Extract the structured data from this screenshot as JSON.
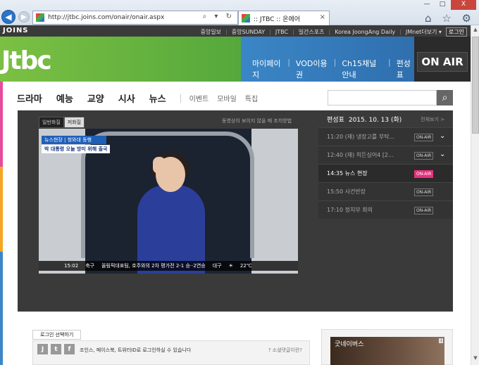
{
  "browser": {
    "url": "http://jtbc.joins.com/onair/onair.aspx",
    "tab_title": ":: JTBC :: 온에어",
    "window_buttons": [
      "—",
      "□",
      "X"
    ],
    "tool_icons": "⌂ ☆ ⚙",
    "addr_icons": "⌕ ▾ ↻"
  },
  "topbar": {
    "brand": "JOINS",
    "links": [
      "중앙일보",
      "중앙SUNDAY",
      "JTBC",
      "일간스포츠",
      "Korea JoongAng Daily",
      "JMnet더보기 ▾"
    ],
    "login": "로그인"
  },
  "header": {
    "logo": "Jtbc",
    "links": [
      "마이페이지",
      "VOD이용권",
      "Ch15채널안내",
      "편성표"
    ],
    "onair": "ON AIR",
    "colors": {
      "green": "#7bc043",
      "blue": "#3b86c6",
      "dark": "#2b2b2b"
    }
  },
  "menu": {
    "main": [
      "드라마",
      "예능",
      "교양",
      "시사",
      "뉴스"
    ],
    "sub": [
      "이벤트",
      "모바일",
      "특집"
    ],
    "search_icon": "🔍"
  },
  "player": {
    "quality": [
      "일반화질",
      "저화질"
    ],
    "help": "동영상이 보이지 않을 때 조치방법",
    "caption1": "뉴스현장 | 청와대 동행",
    "caption2": "박 대통령 오늘 방미 위해 출국",
    "ticker": [
      "15:02",
      "축구",
      "올림픽대표팀, 호주와의 2차 평가전 2-1 승··2연승",
      "대구",
      "☀",
      "22℃"
    ]
  },
  "schedule": {
    "title": "편성표",
    "date": "2015. 10. 13 (화)",
    "all": "전체보기 >",
    "items": [
      {
        "text": "11:20 (재) 냉장고를 부탁...",
        "badge": "ON-AIR",
        "current": false
      },
      {
        "text": "12:40 (재) 히든싱어4 [2...",
        "badge": "ON-AIR",
        "current": false
      },
      {
        "text": "14:35 뉴스 현장",
        "badge": "ON-AIR",
        "current": true
      },
      {
        "text": "15:50 사건반장",
        "badge": "ON-AIR",
        "current": false
      },
      {
        "text": "17:10 정치부 회의",
        "badge": "ON-AIR",
        "current": false
      }
    ],
    "live_color": "#e8317e"
  },
  "social": {
    "tip": "로그인 선택하기",
    "text": "조인스, 페이스북, 트위터ID로 로그인하실 수 있습니다",
    "help": "? 소셜댓글이란?",
    "icons": [
      "J",
      "t",
      "f"
    ]
  },
  "ad": {
    "brand": "굿네이버스",
    "info": "i"
  }
}
